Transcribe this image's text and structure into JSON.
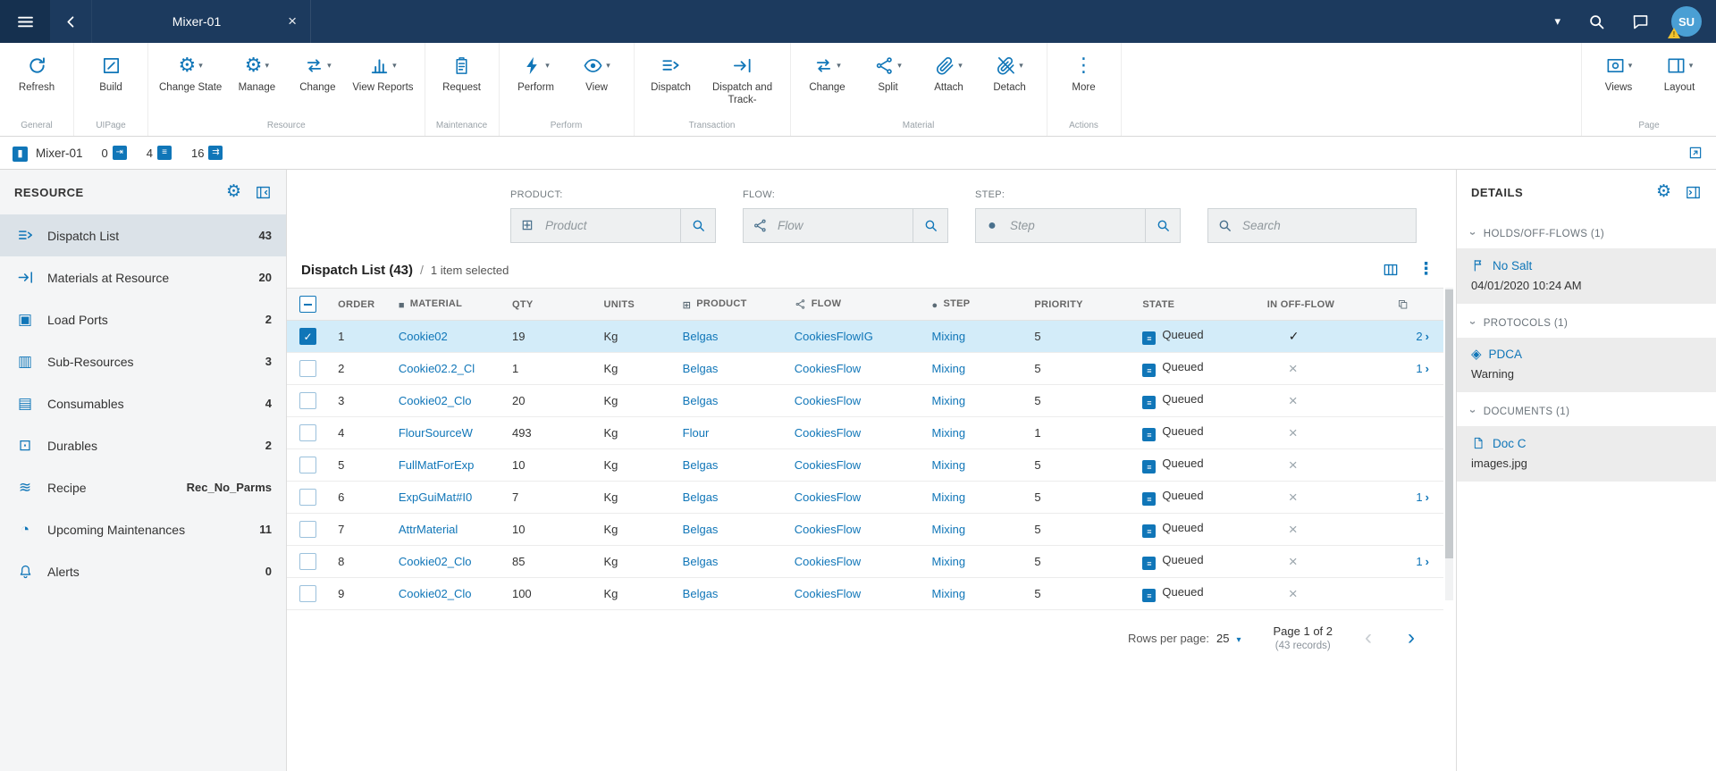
{
  "colors": {
    "accent": "#1076b8",
    "topbar": "#1c3a5e",
    "selected_row": "#d3ecf9",
    "selected_nav_item": "#dbe2e8",
    "detail_card": "#ececec"
  },
  "topbar": {
    "tab_title": "Mixer-01",
    "avatar_initials": "SU"
  },
  "toolbar": {
    "left_groups": [
      {
        "label": "General",
        "buttons": [
          {
            "label": "Refresh",
            "icon": "refresh",
            "caret": false
          }
        ]
      },
      {
        "label": "UIPage",
        "buttons": [
          {
            "label": "Build",
            "icon": "build",
            "caret": false
          }
        ]
      },
      {
        "label": "Resource",
        "buttons": [
          {
            "label": "Change State",
            "icon": "gear",
            "caret": true
          },
          {
            "label": "Manage",
            "icon": "gear",
            "caret": true
          },
          {
            "label": "Change",
            "icon": "swap",
            "caret": true
          },
          {
            "label": "View Reports",
            "icon": "chart",
            "caret": true
          }
        ]
      },
      {
        "label": "Maintenance",
        "buttons": [
          {
            "label": "Request",
            "icon": "clipboard",
            "caret": false
          }
        ]
      },
      {
        "label": "Perform",
        "buttons": [
          {
            "label": "Perform",
            "icon": "bolt",
            "caret": true
          },
          {
            "label": "View",
            "icon": "eye",
            "caret": true
          }
        ]
      },
      {
        "label": "Transaction",
        "buttons": [
          {
            "label": "Dispatch",
            "icon": "dispatch",
            "caret": false
          },
          {
            "label": "Dispatch and Track-",
            "icon": "dispatch-track",
            "caret": false
          }
        ]
      },
      {
        "label": "Material",
        "buttons": [
          {
            "label": "Change",
            "icon": "swap",
            "caret": true
          },
          {
            "label": "Split",
            "icon": "split",
            "caret": true
          },
          {
            "label": "Attach",
            "icon": "paperclip",
            "caret": true
          },
          {
            "label": "Detach",
            "icon": "paperclip-off",
            "caret": true
          }
        ]
      },
      {
        "label": "Actions",
        "buttons": [
          {
            "label": "More",
            "icon": "more",
            "caret": false
          }
        ]
      }
    ],
    "right_groups": [
      {
        "label": "Page",
        "buttons": [
          {
            "label": "Views",
            "icon": "views",
            "caret": true
          },
          {
            "label": "Layout",
            "icon": "layout",
            "caret": true
          }
        ]
      }
    ]
  },
  "statusbar": {
    "title": "Mixer-01",
    "counters": [
      {
        "value": "0",
        "icon": "material-in"
      },
      {
        "value": "4",
        "icon": "material-staged"
      },
      {
        "value": "16",
        "icon": "material-out"
      }
    ]
  },
  "sidebar": {
    "title": "RESOURCE",
    "items": [
      {
        "label": "Dispatch List",
        "badge": "43",
        "icon": "dispatch",
        "selected": true
      },
      {
        "label": "Materials at Resource",
        "badge": "20",
        "icon": "dispatch-track",
        "selected": false
      },
      {
        "label": "Load Ports",
        "badge": "2",
        "icon": "loadport",
        "selected": false
      },
      {
        "label": "Sub-Resources",
        "badge": "3",
        "icon": "subres",
        "selected": false
      },
      {
        "label": "Consumables",
        "badge": "4",
        "icon": "consumables",
        "selected": false
      },
      {
        "label": "Durables",
        "badge": "2",
        "icon": "durables",
        "selected": false
      },
      {
        "label": "Recipe",
        "badge": "Rec_No_Parms",
        "icon": "recipe",
        "selected": false
      },
      {
        "label": "Upcoming Maintenances",
        "badge": "11",
        "icon": "maintenance",
        "selected": false
      },
      {
        "label": "Alerts",
        "badge": "0",
        "icon": "bell",
        "selected": false
      }
    ]
  },
  "filters": {
    "product_label": "PRODUCT:",
    "product_placeholder": "Product",
    "flow_label": "FLOW:",
    "flow_placeholder": "Flow",
    "step_label": "STEP:",
    "step_placeholder": "Step",
    "search_placeholder": "Search"
  },
  "table": {
    "title": "Dispatch List (43)",
    "separator": "/",
    "selection": "1 item selected",
    "columns": [
      {
        "label": "",
        "icon": "checkbox"
      },
      {
        "label": "ORDER"
      },
      {
        "label": "MATERIAL",
        "icon": "material-square"
      },
      {
        "label": "QTY"
      },
      {
        "label": "UNITS"
      },
      {
        "label": "PRODUCT",
        "icon": "grid"
      },
      {
        "label": "FLOW",
        "icon": "flow"
      },
      {
        "label": "STEP",
        "icon": "step"
      },
      {
        "label": "PRIORITY"
      },
      {
        "label": "STATE"
      },
      {
        "label": "IN OFF-FLOW"
      },
      {
        "label": "",
        "icon": "copy"
      }
    ],
    "rows": [
      {
        "order": "1",
        "material": "Cookie02",
        "qty": "19",
        "units": "Kg",
        "product": "Belgas",
        "flow": "CookiesFlowIG",
        "step": "Mixing",
        "priority": "5",
        "state": "Queued",
        "in_off_flow": true,
        "links": "2",
        "selected": true
      },
      {
        "order": "2",
        "material": "Cookie02.2_Cl",
        "qty": "1",
        "units": "Kg",
        "product": "Belgas",
        "flow": "CookiesFlow",
        "step": "Mixing",
        "priority": "5",
        "state": "Queued",
        "in_off_flow": false,
        "links": "1",
        "selected": false
      },
      {
        "order": "3",
        "material": "Cookie02_Clo",
        "qty": "20",
        "units": "Kg",
        "product": "Belgas",
        "flow": "CookiesFlow",
        "step": "Mixing",
        "priority": "5",
        "state": "Queued",
        "in_off_flow": false,
        "links": "",
        "selected": false
      },
      {
        "order": "4",
        "material": "FlourSourceW",
        "qty": "493",
        "units": "Kg",
        "product": "Flour",
        "flow": "CookiesFlow",
        "step": "Mixing",
        "priority": "1",
        "state": "Queued",
        "in_off_flow": false,
        "links": "",
        "selected": false
      },
      {
        "order": "5",
        "material": "FullMatForExp",
        "qty": "10",
        "units": "Kg",
        "product": "Belgas",
        "flow": "CookiesFlow",
        "step": "Mixing",
        "priority": "5",
        "state": "Queued",
        "in_off_flow": false,
        "links": "",
        "selected": false
      },
      {
        "order": "6",
        "material": "ExpGuiMat#I0",
        "qty": "7",
        "units": "Kg",
        "product": "Belgas",
        "flow": "CookiesFlow",
        "step": "Mixing",
        "priority": "5",
        "state": "Queued",
        "in_off_flow": false,
        "links": "1",
        "selected": false
      },
      {
        "order": "7",
        "material": "AttrMaterial",
        "qty": "10",
        "units": "Kg",
        "product": "Belgas",
        "flow": "CookiesFlow",
        "step": "Mixing",
        "priority": "5",
        "state": "Queued",
        "in_off_flow": false,
        "links": "",
        "selected": false
      },
      {
        "order": "8",
        "material": "Cookie02_Clo",
        "qty": "85",
        "units": "Kg",
        "product": "Belgas",
        "flow": "CookiesFlow",
        "step": "Mixing",
        "priority": "5",
        "state": "Queued",
        "in_off_flow": false,
        "links": "1",
        "selected": false
      },
      {
        "order": "9",
        "material": "Cookie02_Clo",
        "qty": "100",
        "units": "Kg",
        "product": "Belgas",
        "flow": "CookiesFlow",
        "step": "Mixing",
        "priority": "5",
        "state": "Queued",
        "in_off_flow": false,
        "links": "",
        "selected": false
      }
    ]
  },
  "pagination": {
    "rows_per_page_label": "Rows per page:",
    "rows_per_page": "25",
    "page_info": "Page 1 of 2",
    "records": "(43 records)"
  },
  "details": {
    "title": "DETAILS",
    "sections": [
      {
        "title": "HOLDS/OFF-FLOWS (1)",
        "icon": "flag",
        "link": "No Salt",
        "sub": "04/01/2020 10:24 AM"
      },
      {
        "title": "PROTOCOLS (1)",
        "icon": "protocol",
        "link": "PDCA",
        "sub": "Warning"
      },
      {
        "title": "DOCUMENTS (1)",
        "icon": "document",
        "link": "Doc C",
        "sub": "images.jpg"
      }
    ]
  }
}
